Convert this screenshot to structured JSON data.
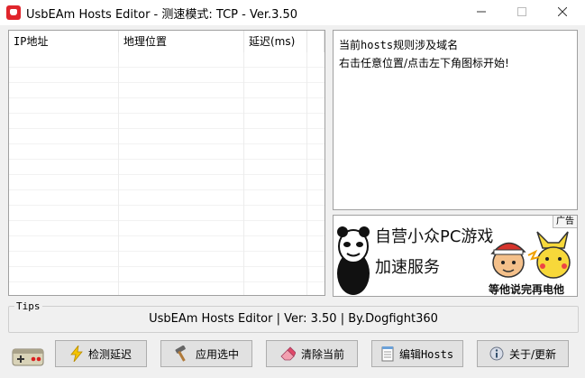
{
  "window": {
    "title": "UsbEAm Hosts Editor - 测速模式: TCP - Ver.3.50"
  },
  "list": {
    "columns": [
      "IP地址",
      "地理位置",
      "延迟(ms)",
      ""
    ]
  },
  "info": {
    "lines": [
      "当前hosts规则涉及域名",
      "右击任意位置/点击左下角图标开始!"
    ]
  },
  "ad": {
    "tag": "广告",
    "line1": "自营小众PC游戏",
    "line2": "加速服务",
    "line3": "等他说完再电他"
  },
  "tips": {
    "legend": "Tips",
    "text": "UsbEAm Hosts Editor | Ver: 3.50 | By.Dogfight360"
  },
  "buttons": {
    "detect": "检测延迟",
    "apply": "应用选中",
    "clear": "清除当前",
    "edit": "编辑Hosts",
    "about": "关于/更新"
  },
  "icons": [
    "app-icon",
    "gamepad-icon",
    "lightning-icon",
    "hammer-icon",
    "eraser-icon",
    "notepad-icon",
    "info-icon"
  ]
}
